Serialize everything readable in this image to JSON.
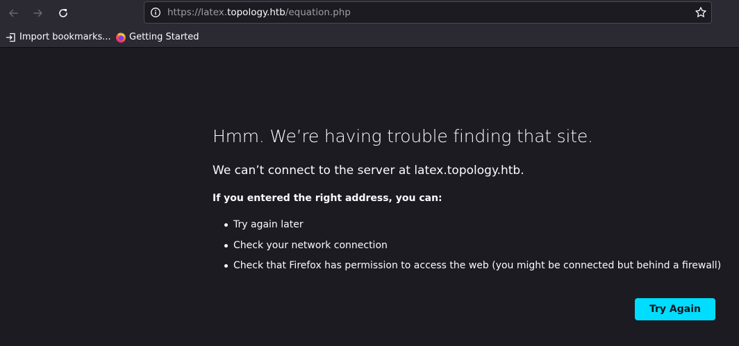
{
  "toolbar": {
    "back_icon": "arrow-left-icon",
    "forward_icon": "arrow-right-icon",
    "reload_icon": "reload-icon",
    "icon_color_disabled": "#6a6a72",
    "icon_color": "#fbfbfe"
  },
  "urlbar": {
    "scheme": "https://",
    "host_prefix": "latex.",
    "host_domain": "topology.htb",
    "path": "/equation.php",
    "info_icon": "info-icon",
    "star_icon": "bookmark-star-icon"
  },
  "bookmarks": {
    "items": [
      {
        "label": "Import bookmarks...",
        "icon": "import-icon"
      },
      {
        "label": "Getting Started",
        "icon": "firefox-icon"
      }
    ]
  },
  "error_page": {
    "title": "Hmm. We’re having trouble finding that site.",
    "description": "We can’t connect to the server at latex.topology.htb.",
    "subhead": "If you entered the right address, you can:",
    "suggestions": [
      "Try again later",
      "Check your network connection",
      "Check that Firefox has permission to access the web (you might be connected but behind a firewall)"
    ],
    "try_again_label": "Try Again",
    "accent_color": "#00ddff",
    "background_color": "#1c1b22"
  }
}
